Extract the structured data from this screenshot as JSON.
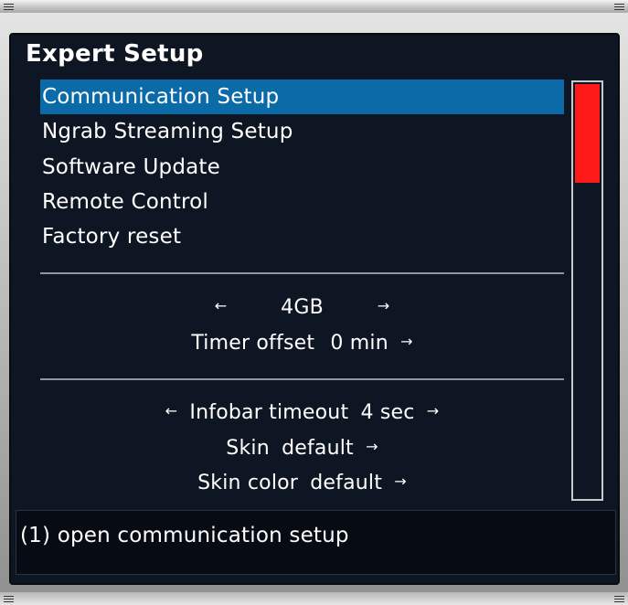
{
  "window": {
    "title": "Expert Setup"
  },
  "menu": {
    "items": [
      {
        "label": "Communication Setup",
        "selected": true
      },
      {
        "label": "Ngrab Streaming Setup",
        "selected": false
      },
      {
        "label": "Software Update",
        "selected": false
      },
      {
        "label": "Remote Control",
        "selected": false
      },
      {
        "label": "Factory reset",
        "selected": false
      }
    ]
  },
  "options": {
    "storage": {
      "left_arrow": "←",
      "value": "4GB",
      "right_arrow": "→"
    },
    "timer_offset": {
      "label": "Timer offset",
      "value": "0 min",
      "right_arrow": "→"
    },
    "infobar_timeout": {
      "left_arrow": "←",
      "label": "Infobar timeout",
      "value": "4 sec",
      "right_arrow": "→"
    },
    "skin": {
      "label": "Skin",
      "value": "default",
      "right_arrow": "→"
    },
    "skin_color": {
      "label": "Skin color",
      "value": "default",
      "right_arrow": "→"
    }
  },
  "scrollbar": {
    "thumb_fraction": 0.24,
    "thumb_color": "#ff1a1a"
  },
  "info": {
    "text": "(1) open communication setup"
  },
  "colors": {
    "background": "#0f1623",
    "selection": "#0b6aa8",
    "text": "#ffffff",
    "divider": "#8e96a2"
  }
}
